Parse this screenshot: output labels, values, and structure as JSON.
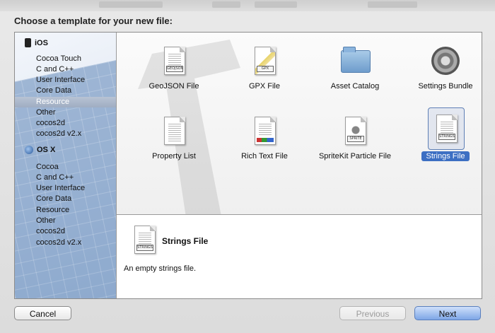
{
  "window": {
    "title": "Choose a template for your new file:"
  },
  "sidebar": {
    "groups": [
      {
        "label": "iOS",
        "icon": "iphone-icon",
        "items": [
          "Cocoa Touch",
          "C and C++",
          "User Interface",
          "Core Data",
          "Resource",
          "Other",
          "cocos2d",
          "cocos2d v2.x"
        ]
      },
      {
        "label": "OS X",
        "icon": "osx-icon",
        "items": [
          "Cocoa",
          "C and C++",
          "User Interface",
          "Core Data",
          "Resource",
          "Other",
          "cocos2d",
          "cocos2d v2.x"
        ]
      }
    ],
    "selected": "Resource"
  },
  "templates": [
    {
      "label": "GeoJSON File",
      "icon": "geojson-file-icon",
      "tag": "GEOJSON"
    },
    {
      "label": "GPX File",
      "icon": "gpx-file-icon",
      "tag": "GPX"
    },
    {
      "label": "Asset Catalog",
      "icon": "folder-icon"
    },
    {
      "label": "Settings Bundle",
      "icon": "gear-icon"
    },
    {
      "label": "Property List",
      "icon": "property-list-icon"
    },
    {
      "label": "Rich Text File",
      "icon": "rich-text-file-icon"
    },
    {
      "label": "SpriteKit Particle File",
      "icon": "sprite-file-icon",
      "tag": "SPRITE"
    },
    {
      "label": "Strings File",
      "icon": "strings-file-icon",
      "tag": "STRINGS",
      "selected": true
    }
  ],
  "detail": {
    "name": "Strings File",
    "description": "An empty strings file.",
    "icon_tag": "STRINGS"
  },
  "buttons": {
    "cancel": "Cancel",
    "previous": "Previous",
    "next": "Next"
  },
  "colors": {
    "selection": "#3d6fc3",
    "next_button": "#7ea6e6"
  }
}
